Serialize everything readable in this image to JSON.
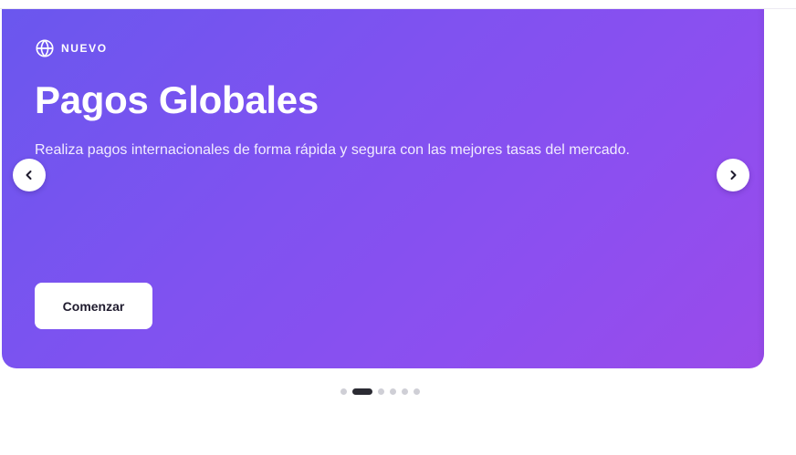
{
  "slide": {
    "badge": "NUEVO",
    "badge_icon": "globe-icon",
    "title": "Pagos Globales",
    "description": "Realiza pagos internacionales de forma rápida y segura con las mejores tasas del mercado.",
    "cta_label": "Comenzar"
  },
  "navigation": {
    "prev_icon": "chevron-left-icon",
    "next_icon": "chevron-right-icon",
    "slide_count": 6,
    "active_index": 1
  },
  "colors": {
    "gradient_start": "#6a57ee",
    "gradient_end": "#9a4bea",
    "text_on_slide": "#ffffff",
    "cta_background": "#ffffff",
    "cta_text": "#1f1b2e",
    "dot_inactive": "#cfcfd6",
    "dot_active": "#2b2b33"
  }
}
